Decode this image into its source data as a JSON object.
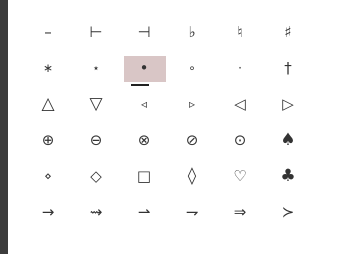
{
  "palette": {
    "background": "#3c3c3c",
    "panel": "#ffffff",
    "symbol_color": "#333333",
    "selection_highlight": "#d9c6c6"
  },
  "symbols": [
    [
      "–",
      "⊢",
      "⊣",
      "♭",
      "♮",
      "♯"
    ],
    [
      "∗",
      "⋆",
      "•",
      "∘",
      "·",
      "†"
    ],
    [
      "△",
      "▽",
      "◃",
      "▹",
      "◁",
      "▷"
    ],
    [
      "⊕",
      "⊖",
      "⊗",
      "⊘",
      "⊙",
      "♠"
    ],
    [
      "⋄",
      "◇",
      "□",
      "◊",
      "♡",
      "♣"
    ],
    [
      "→",
      "⇝",
      "⇀",
      "⇁",
      "⇒",
      "≻"
    ]
  ],
  "selected": {
    "row": 1,
    "col": 2
  }
}
